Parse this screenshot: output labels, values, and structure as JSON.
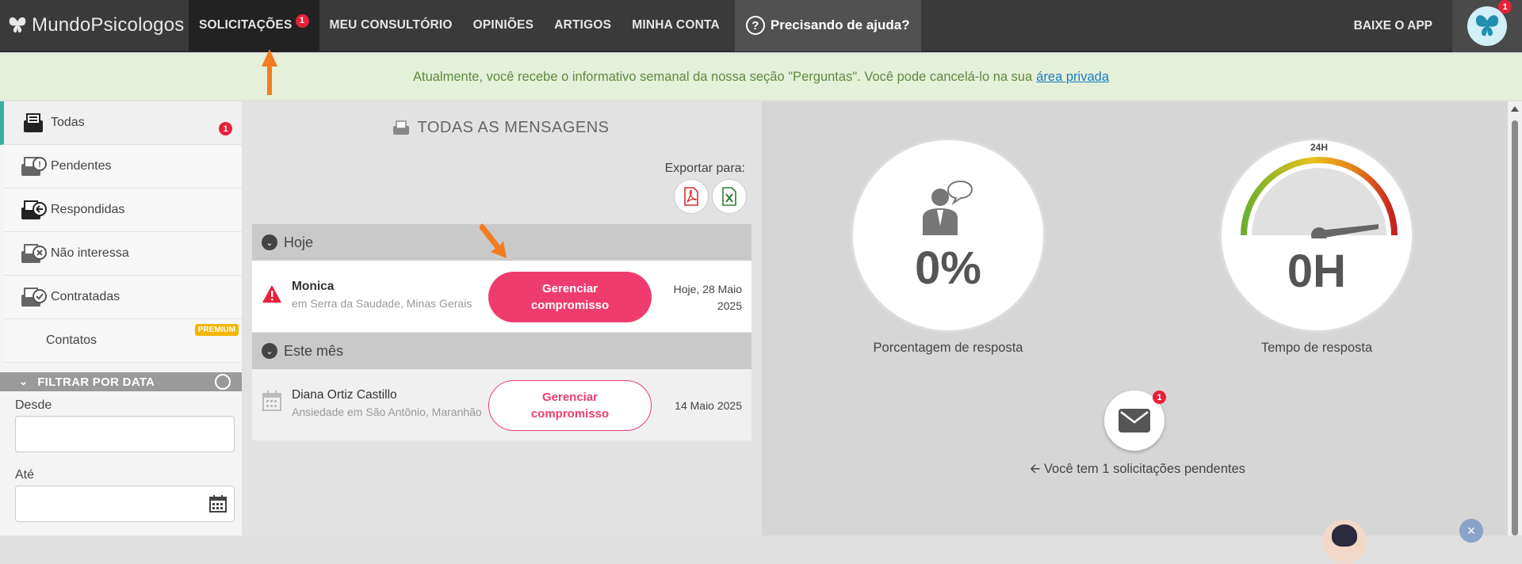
{
  "logo": {
    "text": "MundoPsicologos"
  },
  "nav": {
    "items": [
      {
        "label": "SOLICITAÇÕES",
        "badge": "1"
      },
      {
        "label": "MEU CONSULTÓRIO"
      },
      {
        "label": "OPINIÕES"
      },
      {
        "label": "ARTIGOS"
      },
      {
        "label": "MINHA CONTA"
      }
    ],
    "help": "Precisando de ajuda?",
    "app": "BAIXE O APP",
    "avatar_badge": "1"
  },
  "infobar": {
    "text": "Atualmente, você recebe o informativo semanal da nossa seção \"Perguntas\". Você pode cancelá-lo na sua",
    "link": "área privada"
  },
  "sidebar": {
    "items": [
      {
        "label": "Todas",
        "icon": "inbox-all-icon",
        "badge": "1"
      },
      {
        "label": "Pendentes",
        "icon": "inbox-pending-icon"
      },
      {
        "label": "Respondidas",
        "icon": "inbox-replied-icon"
      },
      {
        "label": "Não interessa",
        "icon": "inbox-rejected-icon"
      },
      {
        "label": "Contratadas",
        "icon": "inbox-hired-icon"
      },
      {
        "label": "Contatos",
        "premium": "PREMIUM"
      }
    ],
    "filter": {
      "title": "FILTRAR POR DATA",
      "from_label": "Desde",
      "to_label": "Até"
    }
  },
  "messages": {
    "title": "TODAS AS MENSAGENS",
    "export_label": "Exportar para:",
    "groups": [
      {
        "title": "Hoje",
        "rows": [
          {
            "name": "Monica",
            "sub": "em Serra da Saudade, Minas Gerais",
            "button": [
              "Gerenciar",
              "compromisso"
            ],
            "date": [
              "Hoje, 28 Maio",
              "2025"
            ],
            "icon": "warning-icon"
          }
        ]
      },
      {
        "title": "Este mês",
        "rows": [
          {
            "name": "Diana Ortiz Castillo",
            "sub": "Ansiedade em São Antônio, Maranhão",
            "button": [
              "Gerenciar",
              "compromisso"
            ],
            "date": [
              "14 Maio 2025"
            ],
            "icon": "calendar-icon"
          }
        ]
      }
    ]
  },
  "stats": {
    "response_rate": {
      "value": "0%",
      "label": "Porcentagem de resposta"
    },
    "response_time": {
      "value": "0H",
      "label": "Tempo de resposta",
      "gauge_max": "24H"
    },
    "pending": {
      "badge": "1",
      "text": "Você tem 1 solicitações pendentes"
    }
  },
  "colors": {
    "accent": "#ef3c6e",
    "teal": "#36b0a4",
    "badge": "#e8203a",
    "arrow": "#f47c20"
  }
}
